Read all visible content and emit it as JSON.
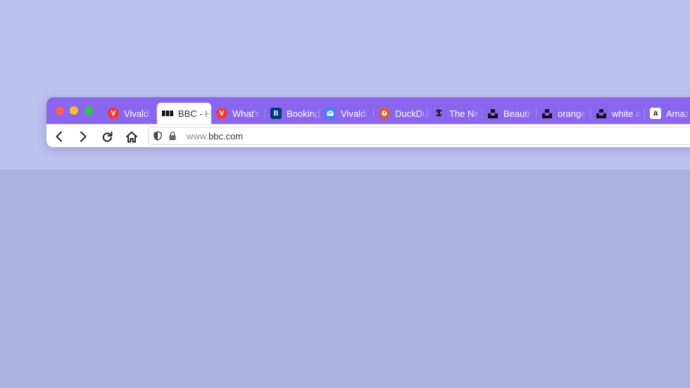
{
  "browser": {
    "accent_color": "#8a66ee",
    "tabs": [
      {
        "title": "Vivaldi",
        "favicon": "vivaldi-icon",
        "active": false
      },
      {
        "title": "BBC - H",
        "favicon": "bbc-icon",
        "active": true
      },
      {
        "title": "What's",
        "favicon": "vivaldi-icon",
        "active": false
      },
      {
        "title": "Booking",
        "favicon": "booking-icon",
        "active": false
      },
      {
        "title": "Vivaldi",
        "favicon": "mail-icon",
        "active": false
      },
      {
        "title": "DuckDu",
        "favicon": "duckduckgo-icon",
        "active": false
      },
      {
        "title": "The Ne",
        "favicon": "nytimes-icon",
        "active": false
      },
      {
        "title": "Beautif",
        "favicon": "unsplash-icon",
        "active": false
      },
      {
        "title": "orange",
        "favicon": "unsplash-icon",
        "active": false
      },
      {
        "title": "white a",
        "favicon": "unsplash-icon",
        "active": false
      },
      {
        "title": "Amaz",
        "favicon": "amazon-icon",
        "active": false
      }
    ],
    "toolbar": {
      "back": "back-icon",
      "forward": "forward-icon",
      "reload": "reload-icon",
      "home": "home-icon"
    },
    "address": {
      "prefix": "www.",
      "domain": "bbc.com"
    }
  }
}
